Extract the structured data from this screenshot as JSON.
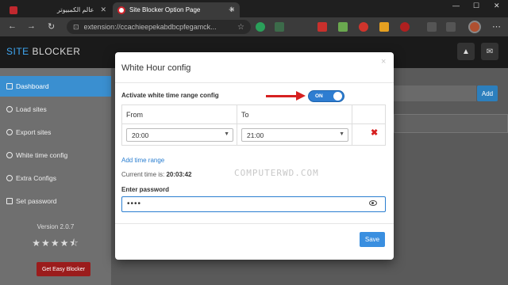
{
  "browser": {
    "tabs": [
      {
        "label": "عالم الكمبيوتر"
      },
      {
        "label": "Site Blocker Option Page"
      }
    ],
    "url": "extension://ccachieepekabdbcpfegamck..."
  },
  "app": {
    "brand_part1": "SITE",
    "brand_part2": "BLOCKER"
  },
  "sidebar": {
    "items": [
      {
        "label": "Dashboard"
      },
      {
        "label": "Load sites"
      },
      {
        "label": "Export sites"
      },
      {
        "label": "White time config"
      },
      {
        "label": "Extra Configs"
      },
      {
        "label": "Set password"
      }
    ],
    "version": "Version 2.0.7",
    "rating": 4.5,
    "cta_label": "Get Easy Blocker"
  },
  "main": {
    "add_label": "Add"
  },
  "modal": {
    "title": "White Hour config",
    "activate_label": "Activate white time range config",
    "toggle_label": "ON",
    "table": {
      "headers": [
        "From",
        "To"
      ],
      "rows": [
        {
          "from": "20:00",
          "to": "21:00"
        }
      ]
    },
    "add_range_label": "Add time range",
    "current_time_label": "Current time is:",
    "current_time_value": "20:03:42",
    "password_label": "Enter password",
    "password_value": "••••",
    "save_label": "Save"
  },
  "watermark": "COMPUTERWD.COM",
  "colors": {
    "accent": "#3a8fd0",
    "annotation_arrow": "#d62020",
    "danger": "#9b1c1c"
  }
}
